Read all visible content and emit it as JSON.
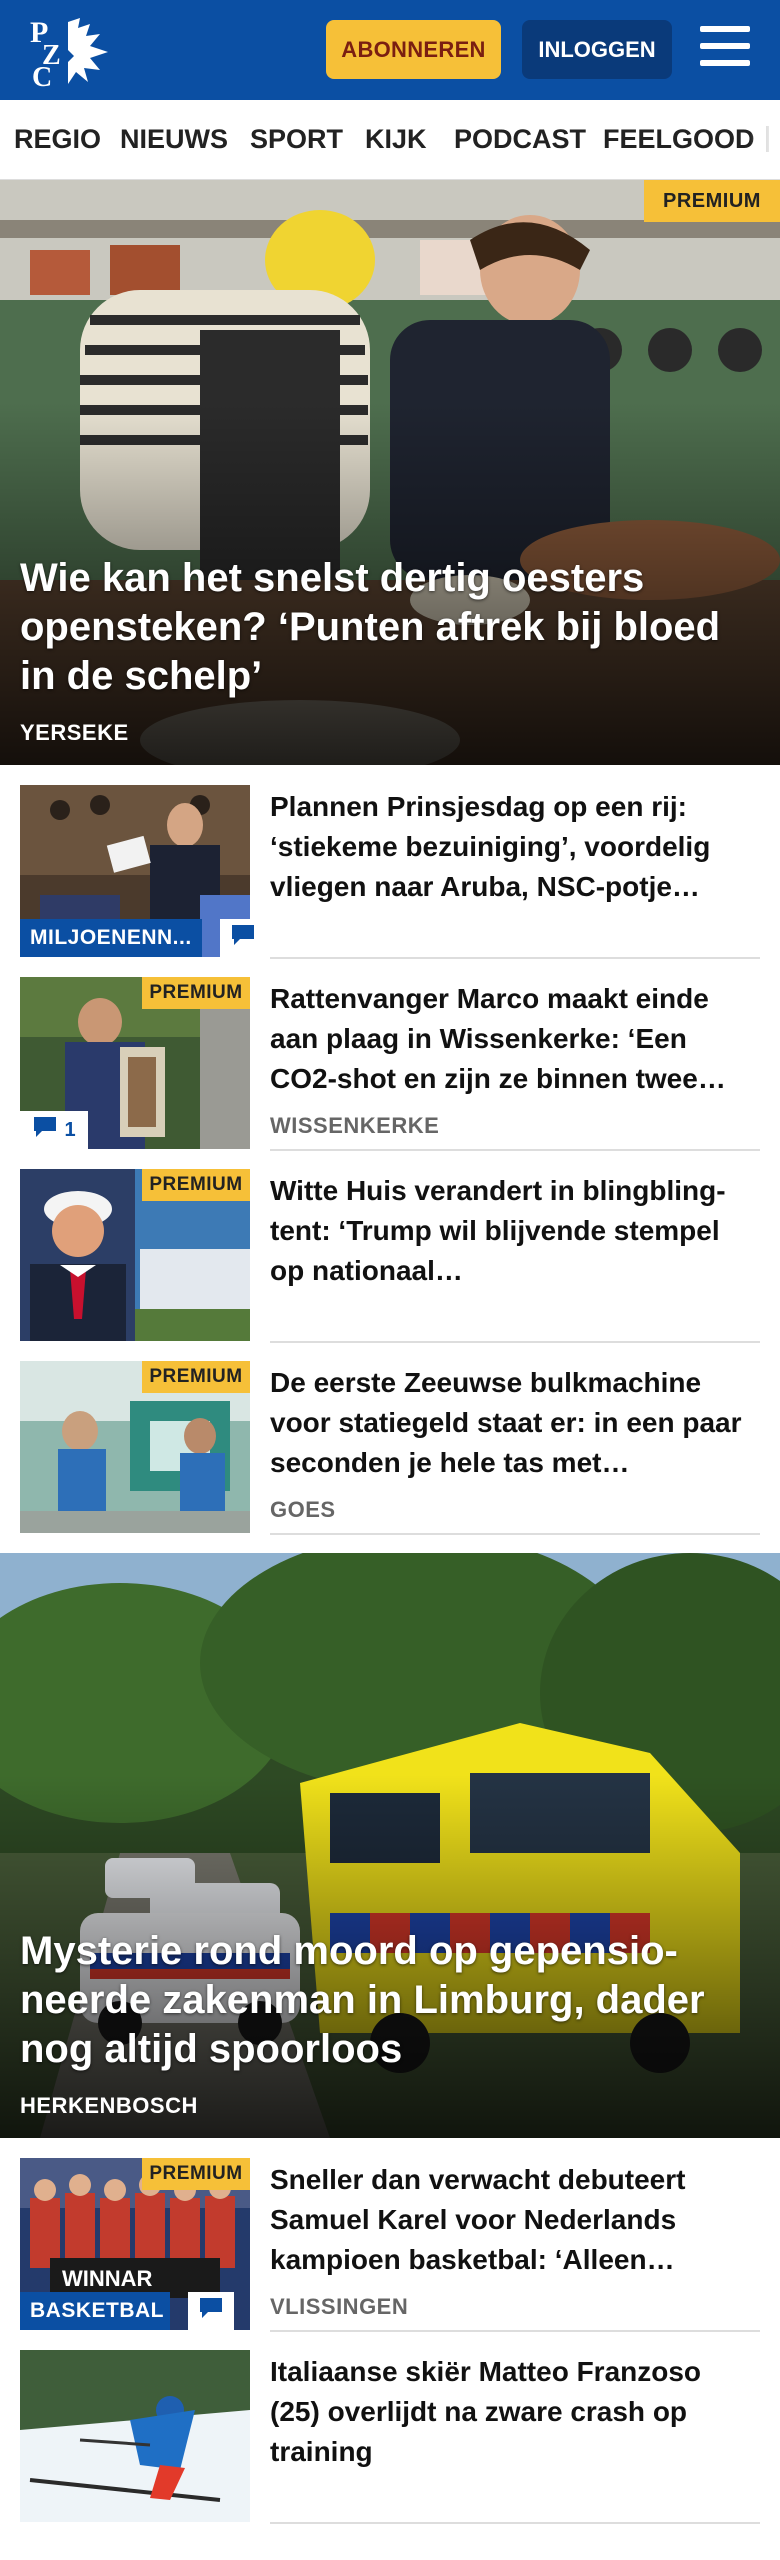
{
  "header": {
    "logo_text": "PZC",
    "subscribe_label": "ABONNEREN",
    "login_label": "INLOGGEN"
  },
  "nav": {
    "items": [
      "REGIO",
      "NIEUWS",
      "SPORT",
      "KIJK",
      "PODCAST",
      "FEELGOOD"
    ]
  },
  "hero1": {
    "badge": "PREMIUM",
    "title": "Wie kan het snelst dertig oesters opensteken? ‘Punten aftrek bij bloed in de schelp’",
    "location": "YERSEKE"
  },
  "articles1": [
    {
      "headline": "Plannen Prinsjesdag op een rij: ‘stiekeme bezuiniging’, voordelig vliegen naar Aruba, NSC-potje…",
      "category": "MILJOENENN...",
      "location": ""
    },
    {
      "headline": "Rattenvanger Marco maakt einde aan plaag in Wissenkerke: ‘Een CO2-shot en zijn ze binnen twee…",
      "badge": "PREMIUM",
      "comments": "1",
      "location": "WISSENKERKE"
    },
    {
      "headline": "Witte Huis verandert in blingbling-tent: ‘Trump wil blijvende stempel op nationaal…",
      "badge": "PREMIUM",
      "location": ""
    },
    {
      "headline": "De eerste Zeeuwse bulkmachine voor statiegeld staat er: in een paar seconden je hele tas met…",
      "badge": "PREMIUM",
      "location": "GOES"
    }
  ],
  "hero2": {
    "title": "Mysterie rond moord op gepensio­neerde zakenman in Limburg, dader nog altijd spoorloos",
    "location": "HERKENBOSCH"
  },
  "articles2": [
    {
      "headline": "Sneller dan verwacht debuteert Samuel Karel voor Nederlands kampioen basketbal: ‘Alleen…",
      "badge": "PREMIUM",
      "category": "BASKETBAL",
      "location": "VLISSINGEN"
    },
    {
      "headline": "Italiaanse skiër Matteo Franzoso (25) overlijdt na zware crash op training",
      "location": ""
    }
  ],
  "colors": {
    "brand_blue": "#0b4fa3",
    "premium_yellow": "#f6c038",
    "subscribe_text": "#7a1f11"
  },
  "icons": [
    "menu-icon",
    "comment-icon"
  ]
}
